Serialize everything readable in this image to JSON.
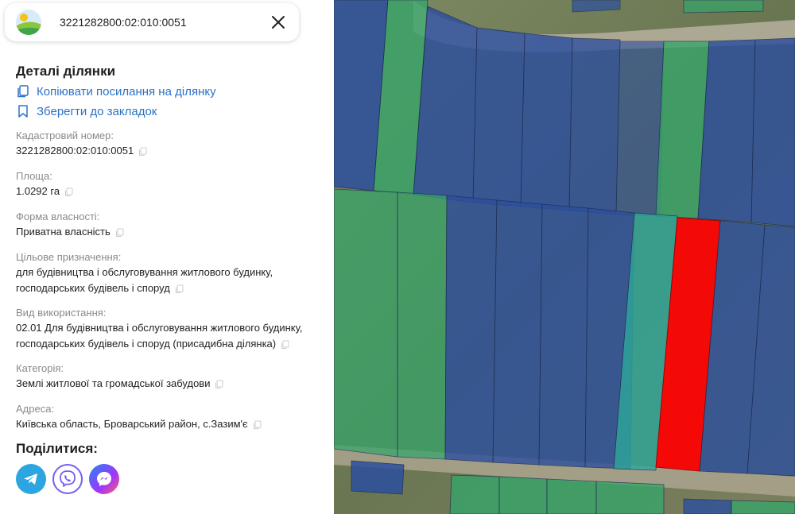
{
  "search": {
    "value": "3221282800:02:010:0051"
  },
  "details": {
    "title": "Деталі ділянки",
    "copy_link": "Копіювати посилання на ділянку",
    "bookmark": "Зберегти до закладок"
  },
  "fields": [
    {
      "label": "Кадастровий номер:",
      "value": "3221282800:02:010:0051"
    },
    {
      "label": "Площа:",
      "value": "1.0292 га"
    },
    {
      "label": "Форма власності:",
      "value": "Приватна власність"
    },
    {
      "label": "Цільове призначення:",
      "value_lines": [
        "для будівництва і обслуговування житлового будинку,",
        "господарських будівель і споруд"
      ]
    },
    {
      "label": "Вид використання:",
      "value_lines": [
        "02.01 Для будівництва і обслуговування житлового будинку,",
        "господарських будівель і споруд (присадибна ділянка)"
      ]
    },
    {
      "label": "Категорія:",
      "value": "Землі житлової та громадської забудови"
    },
    {
      "label": "Адреса:",
      "value": "Київська область, Броварський район, с.Зазим'є"
    }
  ],
  "share": {
    "title": "Поділитися:",
    "buttons": [
      {
        "name": "telegram",
        "color": "#2ca5e0",
        "icon": "telegram-icon"
      },
      {
        "name": "viber",
        "color": "#7360f2",
        "icon": "viber-icon"
      },
      {
        "name": "messenger",
        "color": "#a334fa",
        "icon": "messenger-icon"
      }
    ]
  },
  "map": {
    "colors": {
      "residential": "#2c4f9e",
      "agricultural": "#36a66a",
      "selected": "#ff0000",
      "satellite": "#6b7a55"
    }
  }
}
